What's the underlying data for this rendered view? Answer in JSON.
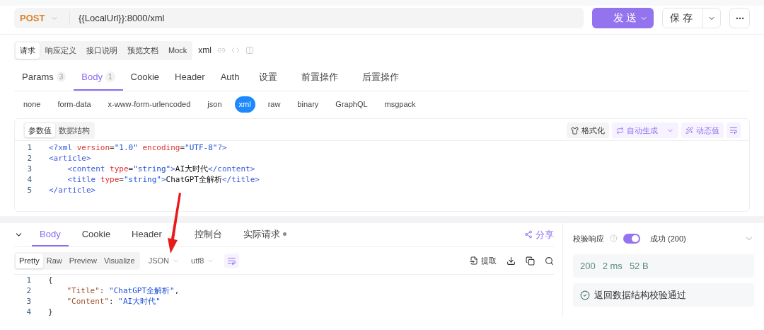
{
  "request": {
    "method": "POST",
    "url": "{{LocalUrl}}:8000/xml",
    "send": "发送",
    "save": "保存"
  },
  "doc_tabs": [
    {
      "label": "请求",
      "selected": true
    },
    {
      "label": "响应定义",
      "selected": false
    },
    {
      "label": "接口说明",
      "selected": false
    },
    {
      "label": "预览文档",
      "selected": false
    },
    {
      "label": "Mock",
      "selected": false
    }
  ],
  "api_name": "xml",
  "tabs": [
    {
      "label": "Params",
      "count": "3",
      "selected": false
    },
    {
      "label": "Body",
      "count": "1",
      "selected": true
    },
    {
      "label": "Cookie",
      "selected": false
    },
    {
      "label": "Header",
      "selected": false
    },
    {
      "label": "Auth",
      "selected": false
    },
    {
      "label": "设置",
      "selected": false
    },
    {
      "label": "前置操作",
      "selected": false
    },
    {
      "label": "后置操作",
      "selected": false
    }
  ],
  "body_types": [
    {
      "label": "none",
      "selected": false
    },
    {
      "label": "form-data",
      "selected": false
    },
    {
      "label": "x-www-form-urlencoded",
      "selected": false
    },
    {
      "label": "json",
      "selected": false
    },
    {
      "label": "xml",
      "selected": true
    },
    {
      "label": "raw",
      "selected": false
    },
    {
      "label": "binary",
      "selected": false
    },
    {
      "label": "GraphQL",
      "selected": false
    },
    {
      "label": "msgpack",
      "selected": false
    }
  ],
  "editor_tabs": [
    {
      "label": "参数值",
      "selected": true
    },
    {
      "label": "数据结构",
      "selected": false
    }
  ],
  "editor_tools": {
    "format": "格式化",
    "autogen": "自动生成",
    "dynamic": "动态值"
  },
  "request_code": [
    {
      "no": "1",
      "tokens": [
        {
          "text": "<?xml ",
          "kind": "tag"
        },
        {
          "text": "version",
          "kind": "attr"
        },
        {
          "text": "=",
          "kind": "punct"
        },
        {
          "text": "\"1.0\"",
          "kind": "str"
        },
        {
          "text": " encoding",
          "kind": "attr"
        },
        {
          "text": "=",
          "kind": "punct"
        },
        {
          "text": "\"UTF-8\"",
          "kind": "str"
        },
        {
          "text": "?>",
          "kind": "tag"
        }
      ]
    },
    {
      "no": "2",
      "tokens": [
        {
          "text": "<article>",
          "kind": "tag"
        }
      ]
    },
    {
      "no": "3",
      "tokens": [
        {
          "text": "    <content ",
          "kind": "tag"
        },
        {
          "text": "type",
          "kind": "attr"
        },
        {
          "text": "=",
          "kind": "punct"
        },
        {
          "text": "\"string\"",
          "kind": "str"
        },
        {
          "text": ">",
          "kind": "tag"
        },
        {
          "text": "AI大时代",
          "kind": "plain"
        },
        {
          "text": "</content>",
          "kind": "tag"
        }
      ]
    },
    {
      "no": "4",
      "tokens": [
        {
          "text": "    <title ",
          "kind": "tag"
        },
        {
          "text": "type",
          "kind": "attr"
        },
        {
          "text": "=",
          "kind": "punct"
        },
        {
          "text": "\"string\"",
          "kind": "str"
        },
        {
          "text": ">",
          "kind": "tag"
        },
        {
          "text": "ChatGPT全解析",
          "kind": "plain"
        },
        {
          "text": "</title>",
          "kind": "tag"
        }
      ]
    },
    {
      "no": "5",
      "tokens": [
        {
          "text": "</article>",
          "kind": "tag"
        }
      ]
    }
  ],
  "response_tabs": [
    {
      "label": "Body",
      "selected": true
    },
    {
      "label": "Cookie",
      "selected": false
    },
    {
      "label": "Header",
      "selected": false
    },
    {
      "label": "控制台",
      "selected": false
    },
    {
      "label": "实际请求",
      "dot": true,
      "selected": false
    }
  ],
  "share": "分享",
  "view_modes": [
    {
      "label": "Pretty",
      "selected": true
    },
    {
      "label": "Raw",
      "selected": false
    },
    {
      "label": "Preview",
      "selected": false
    },
    {
      "label": "Visualize",
      "selected": false
    }
  ],
  "format_select": "JSON",
  "encoding_select": "utf8",
  "extract": "提取",
  "response_code": [
    {
      "no": "1",
      "tokens": [
        {
          "text": "{",
          "kind": "punct"
        }
      ]
    },
    {
      "no": "2",
      "tokens": [
        {
          "text": "    \"Title\"",
          "kind": "key"
        },
        {
          "text": ": ",
          "kind": "punct"
        },
        {
          "text": "\"ChatGPT全解析\"",
          "kind": "str"
        },
        {
          "text": ",",
          "kind": "punct"
        }
      ]
    },
    {
      "no": "3",
      "tokens": [
        {
          "text": "    \"Content\"",
          "kind": "key"
        },
        {
          "text": ": ",
          "kind": "punct"
        },
        {
          "text": "\"AI大时代\"",
          "kind": "str"
        }
      ]
    },
    {
      "no": "4",
      "tokens": [
        {
          "text": "}",
          "kind": "punct"
        }
      ]
    }
  ],
  "validation": {
    "label": "校验响应",
    "on": true,
    "result": "成功 (200)"
  },
  "stats": [
    "200",
    "2 ms",
    "52 B"
  ],
  "check_result": "返回数据结构校验通过"
}
